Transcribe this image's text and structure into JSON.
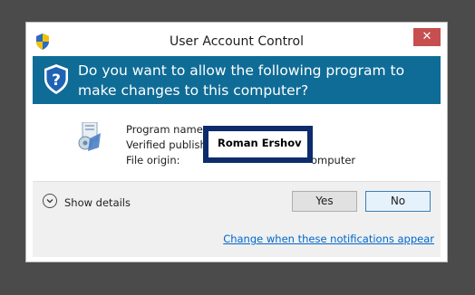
{
  "window": {
    "title": "User Account Control",
    "close_glyph": "✕"
  },
  "banner": {
    "question": "Do you want to allow the following program to make changes to this computer?"
  },
  "program_info": {
    "name_label": "Program name:",
    "publisher_label": "Verified publishe",
    "origin_label": "File origin:",
    "origin_value_visible": "omputer",
    "publisher_overlay": "Roman  Ershov"
  },
  "footer": {
    "show_details": "Show details",
    "yes_label": "Yes",
    "no_label": "No",
    "notifications_link": "Change when these notifications appear"
  },
  "colors": {
    "banner": "#0f6c96",
    "overlay_border": "#0d2c6b",
    "close_button": "#c74f4f",
    "link": "#0066cc"
  },
  "icons": {
    "title": "uac-shield-icon",
    "banner": "uac-shield-icon",
    "program": "installer-icon",
    "details": "chevron-down-icon"
  }
}
